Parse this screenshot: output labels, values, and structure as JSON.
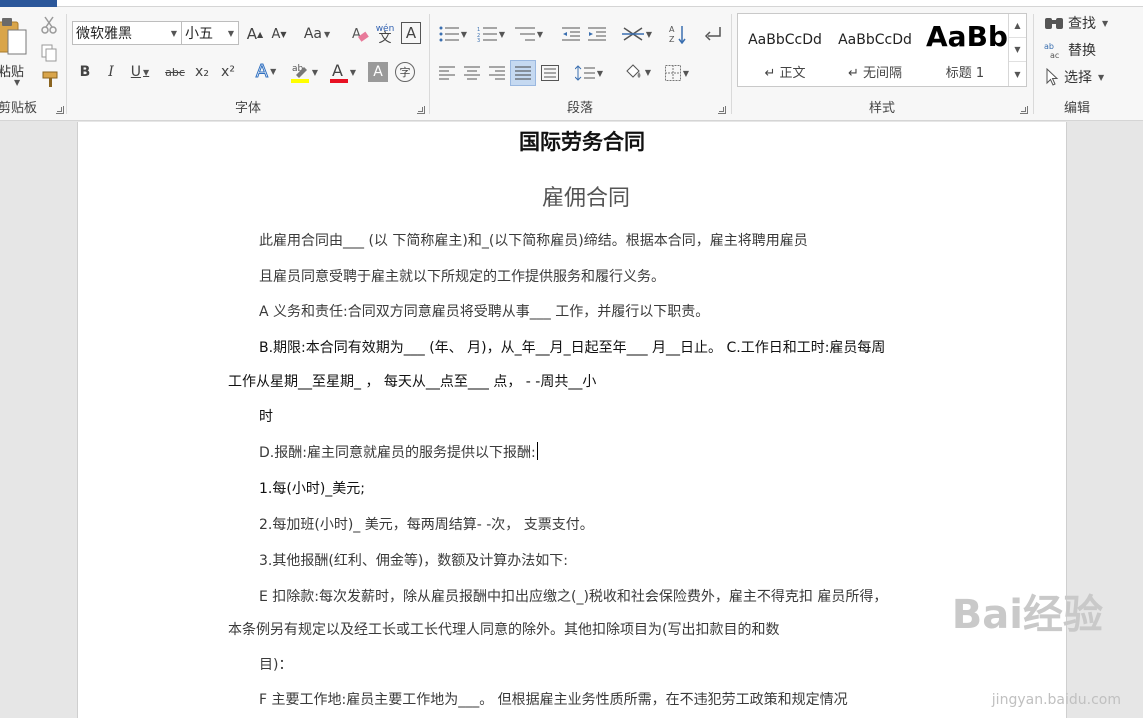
{
  "clipboard": {
    "paste_label": "粘贴",
    "group_label": "剪贴板"
  },
  "font": {
    "name": "微软雅黑",
    "size": "小五",
    "group_label": "字体",
    "grow": "A",
    "shrink": "A",
    "case": "Aa",
    "bold": "B",
    "italic": "I",
    "underline": "U",
    "strike": "abc",
    "subscript": "x₂",
    "superscript": "x²",
    "color_a": "A",
    "phonetic": "wén",
    "border_char": "A",
    "enclose": "字"
  },
  "paragraph": {
    "group_label": "段落"
  },
  "styles": {
    "group_label": "样式",
    "items": [
      {
        "sample": "AaBbCcDd",
        "name": "↵ 正文"
      },
      {
        "sample": "AaBbCcDd",
        "name": "↵ 无间隔"
      },
      {
        "sample": "AaBb",
        "name": "标题 1"
      }
    ]
  },
  "editing": {
    "group_label": "编辑",
    "find": "查找",
    "replace": "替换",
    "select": "选择"
  },
  "document": {
    "title": "国际劳务合同",
    "subtitle": "雇佣合同",
    "paragraphs": [
      "此雇用合同由___ (以  下简称雇主)和_(以下简称雇员)缔结。根据本合同，雇主将聘用雇员",
      "且雇员同意受聘于雇主就以下所规定的工作提供服务和履行义务。",
      "A 义务和责任:合同双方同意雇员将受聘从事___  工作，并履行以下职责。",
      "B.期限:本合同有效期为___ (年、  月)，从_年__月_日起至年___  月__日止。  C.工作日和工时:雇员每周",
      "工作从星期__至星期_ ，   每天从__点至___  点，   - -周共__小",
      "时",
      "D.报酬:雇主同意就雇员的服务提供以下报酬:",
      "1.每(小时)_美元;",
      "2.每加班(小时)_  美元，每两周结算- -次，   支票支付。",
      "3.其他报酬(红利、佣金等)，数额及计算办法如下:",
      "E 扣除款:每次发薪时，除从雇员报酬中扣出应缴之(_)税收和社会保险费外，雇主不得克扣  雇员所得，",
      "本条例另有规定以及经工长或工长代理人同意的除外。其他扣除项目为(写出扣款目的和数",
      "目)：",
      "F 主要工作地:雇员主要工作地为___。  但根据雇主业务性质所需，在不违犯劳工政策和规定情况"
    ]
  },
  "watermark": {
    "logo": "Bai经验",
    "url": "jingyan.baidu.com"
  },
  "colors": {
    "accent": "#2b579a",
    "highlight": "#ffff00",
    "font_red": "#e81123"
  }
}
